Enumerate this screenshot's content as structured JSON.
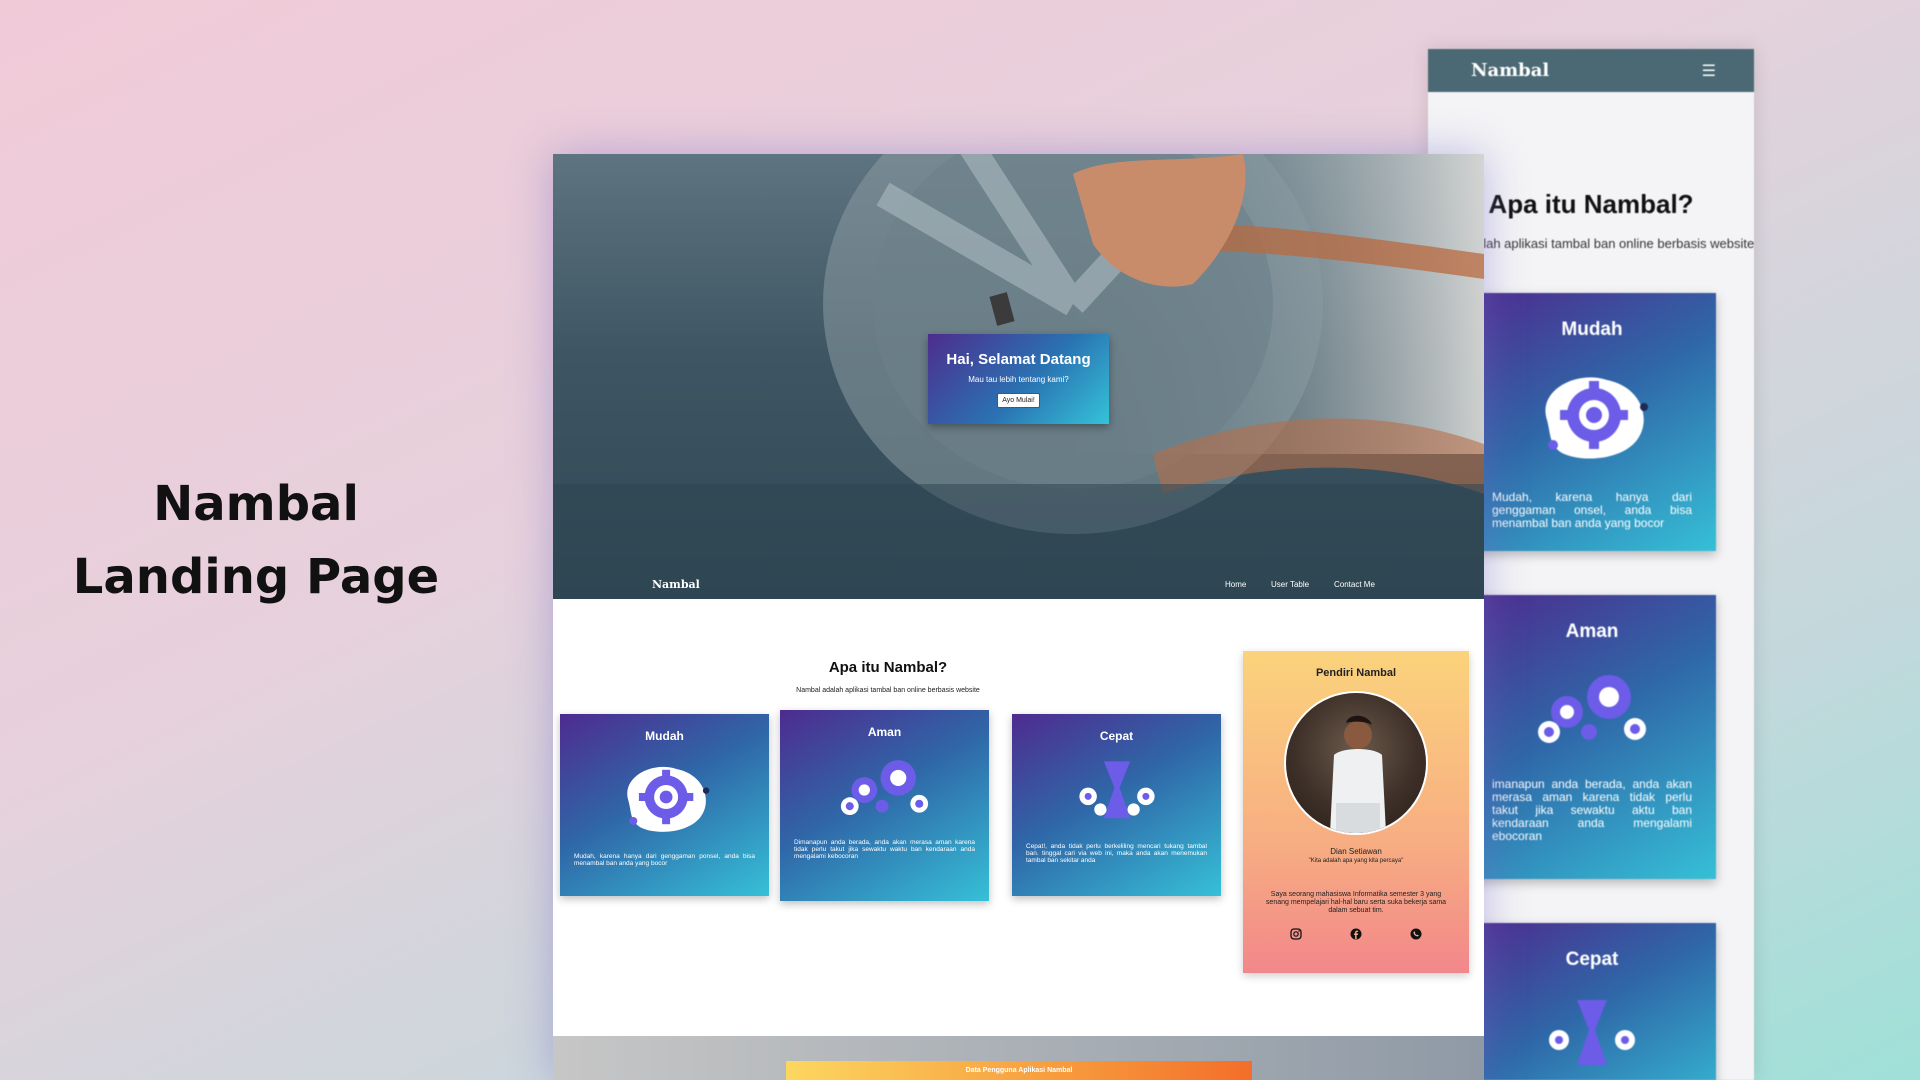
{
  "headline": {
    "line1": "Nambal",
    "line2": "Landing Page"
  },
  "mobile": {
    "brand": "Nambal",
    "menu_icon": "hamburger-icon",
    "title": "Apa itu Nambal?",
    "subtitle": "al adalah aplikasi tambal ban online berbasis website",
    "cards": [
      {
        "title": "Mudah",
        "desc": "Mudah, karena hanya dari genggaman onsel, anda bisa menambal ban anda yang bocor"
      },
      {
        "title": "Aman",
        "desc": "imanapun anda berada, anda akan merasa aman karena tidak perlu takut jika sewaktu aktu ban kendaraan anda mengalami ebocoran"
      },
      {
        "title": "Cepat",
        "desc": ""
      }
    ]
  },
  "desktop": {
    "hero": {
      "title": "Hai, Selamat Datang",
      "subtitle": "Mau tau lebih tentang kami?",
      "button": "Ayo Mulai!"
    },
    "nav": {
      "brand": "Nambal",
      "links": [
        "Home",
        "User Table",
        "Contact Me"
      ]
    },
    "about": {
      "title": "Apa itu Nambal?",
      "subtitle": "Nambal adalah aplikasi tambal ban online berbasis website"
    },
    "cards": [
      {
        "title": "Mudah",
        "desc": "Mudah, karena hanya dari genggaman ponsel, anda bisa menambal ban anda yang bocor"
      },
      {
        "title": "Aman",
        "desc": "Dimanapun anda berada, anda akan merasa aman karena tidak perlu takut jika sewaktu waktu ban kendaraan anda mengalami kebocoran"
      },
      {
        "title": "Cepat",
        "desc": "Cepat!, anda tidak perlu berkeliling mencari tukang tambal ban. tinggal cari via web ini, maka anda akan menemukan tambal ban sekitar anda"
      }
    ],
    "founder": {
      "heading": "Pendiri Nambal",
      "name": "Dian Setiawan",
      "quote": "\"Kita adalah apa yang kita percaya\"",
      "bio": "Saya seorang mahasiswa Informatika semester 3 yang senang mempelajari hal-hal baru serta suka bekerja sama dalam sebuat tim.",
      "socials": [
        "instagram-icon",
        "facebook-icon",
        "whatsapp-icon"
      ]
    },
    "data_section": {
      "title": "Data Pengguna Aplikasi Nambal"
    }
  },
  "colors": {
    "card_start": "#4e2b8f",
    "card_end": "#36c0d7",
    "nav_mobile": "#4b6974",
    "founder_start": "#fbd37c",
    "founder_end": "#f2878a"
  }
}
